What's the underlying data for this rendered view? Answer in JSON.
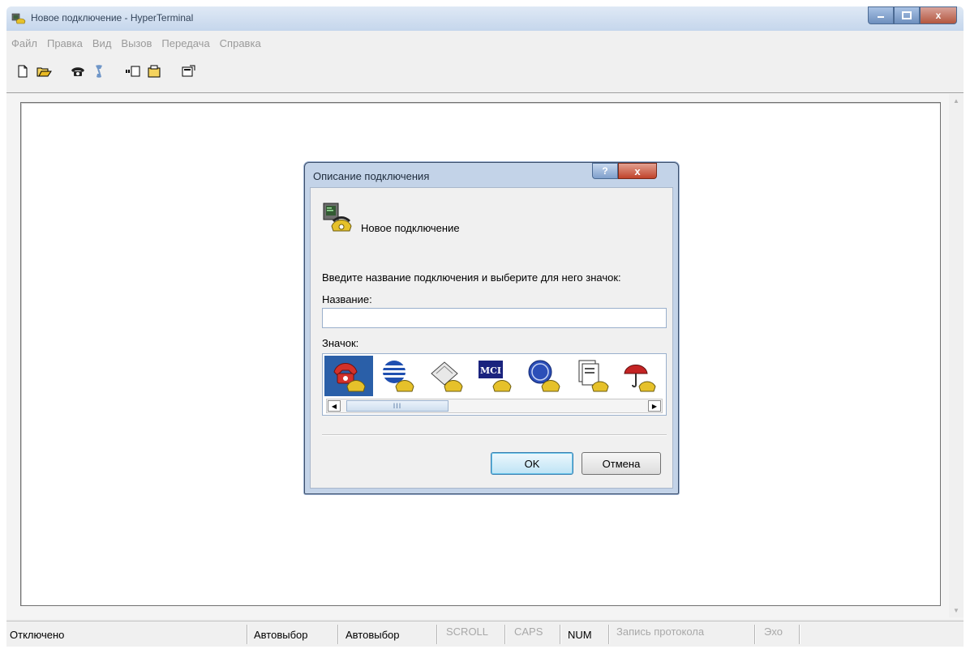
{
  "window": {
    "title": "Новое подключение - HyperTerminal",
    "controls": {
      "minimize": "–",
      "maximize": "□",
      "close": "x"
    }
  },
  "menu": [
    "Файл",
    "Правка",
    "Вид",
    "Вызов",
    "Передача",
    "Справка"
  ],
  "toolbar": [
    {
      "name": "new-icon"
    },
    {
      "name": "open-icon"
    },
    {
      "name": "call-icon"
    },
    {
      "name": "disconnect-icon"
    },
    {
      "name": "send-icon"
    },
    {
      "name": "receive-icon"
    },
    {
      "name": "properties-icon"
    }
  ],
  "statusbar": {
    "connection": "Отключено",
    "detect1": "Автовыбор",
    "detect2": "Автовыбор",
    "scroll": "SCROLL",
    "caps": "CAPS",
    "num": "NUM",
    "capture": "Запись протокола",
    "echo": "Эхо"
  },
  "dialog": {
    "title": "Описание подключения",
    "help": "?",
    "close": "x",
    "connection_name": "Новое подключение",
    "prompt": "Введите название подключения и выберите для него значок:",
    "name_label": "Название:",
    "name_value": "",
    "icon_label": "Значок:",
    "icons": [
      "red-phone-icon",
      "globe-icon",
      "fax-icon",
      "mci-icon",
      "ge-icon",
      "documents-icon",
      "umbrella-icon"
    ],
    "selected_icon_index": 0,
    "scroll_thumb": "III",
    "ok": "OK",
    "cancel": "Отмена"
  },
  "colors": {
    "selection": "#2a5fa8",
    "dialog_frame": "#c3d3e8",
    "close_button": "#c0432a"
  }
}
